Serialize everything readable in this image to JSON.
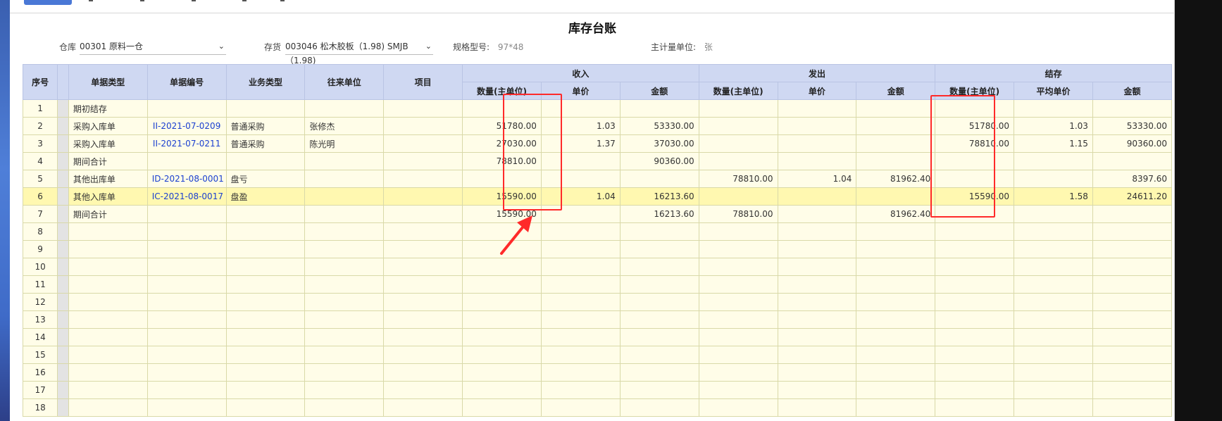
{
  "title": "库存台账",
  "filters": {
    "warehouse_label": "仓库",
    "warehouse_value": "00301 原料一仓",
    "stock_label": "存货",
    "stock_value": "003046 松木胶板（1.98) SMJB（1.98)",
    "spec_label": "规格型号:",
    "spec_value": "97*48",
    "unit_label": "主计量单位:",
    "unit_value": "张"
  },
  "table": {
    "headers": {
      "seq": "序号",
      "doc_type": "单据类型",
      "doc_no": "单据编号",
      "biz_type": "业务类型",
      "partner": "往来单位",
      "project": "项目",
      "in_group": "收入",
      "out_group": "发出",
      "bal_group": "结存",
      "qty": "数量(主单位)",
      "price": "单价",
      "amount": "金额",
      "avg_price": "平均单价"
    },
    "rows": [
      {
        "seq": "1",
        "doc_type": "期初结存",
        "doc_no": "",
        "biz_type": "",
        "partner": "",
        "project": "",
        "in_qty": "",
        "in_price": "",
        "in_amt": "",
        "out_qty": "",
        "out_price": "",
        "out_amt": "",
        "bal_qty": "",
        "bal_price": "",
        "bal_amt": ""
      },
      {
        "seq": "2",
        "doc_type": "采购入库单",
        "doc_no": "II-2021-07-0209",
        "biz_type": "普通采购",
        "partner": "张修杰",
        "project": "",
        "in_qty": "51780.00",
        "in_price": "1.03",
        "in_amt": "53330.00",
        "out_qty": "",
        "out_price": "",
        "out_amt": "",
        "bal_qty": "51780.00",
        "bal_price": "1.03",
        "bal_amt": "53330.00"
      },
      {
        "seq": "3",
        "doc_type": "采购入库单",
        "doc_no": "II-2021-07-0211",
        "biz_type": "普通采购",
        "partner": "陈光明",
        "project": "",
        "in_qty": "27030.00",
        "in_price": "1.37",
        "in_amt": "37030.00",
        "out_qty": "",
        "out_price": "",
        "out_amt": "",
        "bal_qty": "78810.00",
        "bal_price": "1.15",
        "bal_amt": "90360.00"
      },
      {
        "seq": "4",
        "doc_type": "期间合计",
        "doc_no": "",
        "biz_type": "",
        "partner": "",
        "project": "",
        "in_qty": "78810.00",
        "in_price": "",
        "in_amt": "90360.00",
        "out_qty": "",
        "out_price": "",
        "out_amt": "",
        "bal_qty": "",
        "bal_price": "",
        "bal_amt": ""
      },
      {
        "seq": "5",
        "doc_type": "其他出库单",
        "doc_no": "ID-2021-08-0001",
        "biz_type": "盘亏",
        "partner": "",
        "project": "",
        "in_qty": "",
        "in_price": "",
        "in_amt": "",
        "out_qty": "78810.00",
        "out_price": "1.04",
        "out_amt": "81962.40",
        "bal_qty": "",
        "bal_price": "",
        "bal_amt": "8397.60"
      },
      {
        "seq": "6",
        "doc_type": "其他入库单",
        "doc_no": "IC-2021-08-0017",
        "biz_type": "盘盈",
        "partner": "",
        "project": "",
        "in_qty": "15590.00",
        "in_price": "1.04",
        "in_amt": "16213.60",
        "out_qty": "",
        "out_price": "",
        "out_amt": "",
        "bal_qty": "15590.00",
        "bal_price": "1.58",
        "bal_amt": "24611.20"
      },
      {
        "seq": "7",
        "doc_type": "期间合计",
        "doc_no": "",
        "biz_type": "",
        "partner": "",
        "project": "",
        "in_qty": "15590.00",
        "in_price": "",
        "in_amt": "16213.60",
        "out_qty": "78810.00",
        "out_price": "",
        "out_amt": "81962.40",
        "bal_qty": "",
        "bal_price": "",
        "bal_amt": ""
      },
      {
        "seq": "8"
      },
      {
        "seq": "9"
      },
      {
        "seq": "10"
      },
      {
        "seq": "11"
      },
      {
        "seq": "12"
      },
      {
        "seq": "13"
      },
      {
        "seq": "14"
      },
      {
        "seq": "15"
      },
      {
        "seq": "16"
      },
      {
        "seq": "17"
      },
      {
        "seq": "18"
      }
    ],
    "highlight_row": "6"
  },
  "colors": {
    "header_bg": "#cfd8f2",
    "row_bg": "#fffde8",
    "highlight_bg": "#fff8b0",
    "link": "#1a3fd0",
    "annotation": "#ff2a2a"
  }
}
